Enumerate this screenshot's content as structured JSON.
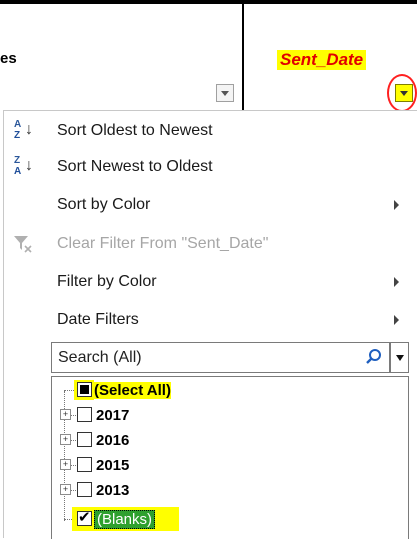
{
  "header": {
    "left_col_text": "es",
    "sent_date_title": "Sent_Date"
  },
  "menu": {
    "sort_oldest": "Sort Oldest to Newest",
    "sort_newest": "Sort Newest to Oldest",
    "sort_by_color": "Sort by Color",
    "clear_filter": "Clear Filter From \"Sent_Date\"",
    "filter_by_color": "Filter by Color",
    "date_filters": "Date Filters"
  },
  "search": {
    "value": "Search (All)"
  },
  "tree": {
    "select_all": "(Select All)",
    "items": [
      "2017",
      "2016",
      "2015",
      "2013"
    ],
    "blanks": "(Blanks)"
  },
  "colors": {
    "highlight": "#ffff00",
    "title_text": "#e00000",
    "annotation_circle": "#ff2020",
    "blanks_bg": "#2ea02e"
  }
}
